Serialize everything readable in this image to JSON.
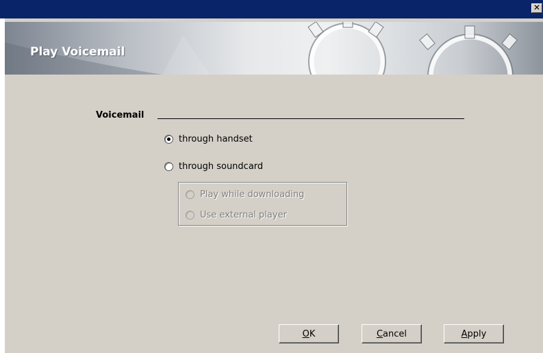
{
  "window": {
    "close_glyph": "✕"
  },
  "banner": {
    "title": "Play Voicemail"
  },
  "voicemail": {
    "group_label": "Voicemail",
    "options": [
      {
        "label": "through handset",
        "checked": true,
        "enabled": true
      },
      {
        "label": "through soundcard",
        "checked": false,
        "enabled": true
      }
    ],
    "sub_options": [
      {
        "label": "Play while downloading",
        "checked": false,
        "enabled": false
      },
      {
        "label": "Use external player",
        "checked": false,
        "enabled": false
      }
    ]
  },
  "buttons": {
    "ok": {
      "mnemonic": "O",
      "rest": "K"
    },
    "cancel": {
      "mnemonic": "C",
      "rest": "ancel"
    },
    "apply": {
      "mnemonic": "A",
      "rest": "pply"
    }
  },
  "colors": {
    "titlebar": "#0a246a",
    "dialog_face": "#d4d0c8",
    "disabled_text": "#808080"
  }
}
